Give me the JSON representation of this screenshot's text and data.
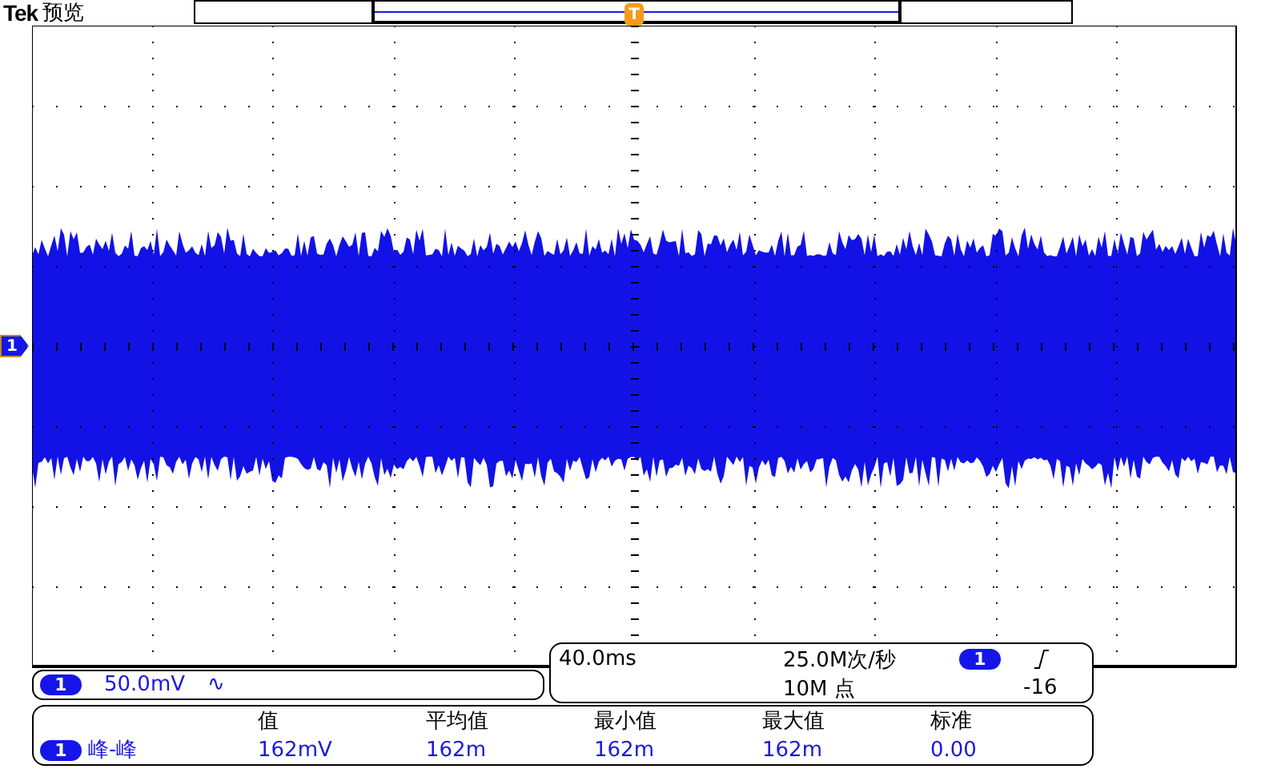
{
  "header": {
    "brand": "Tek",
    "mode": "预览"
  },
  "trigger_position": {
    "label": "T"
  },
  "channel_marker": {
    "label": "1"
  },
  "channel_scale": {
    "channel": "1",
    "scale": "50.0mV",
    "coupling_symbol": "∿"
  },
  "timebase": {
    "time_per_div": "40.0ms",
    "sample_rate": "25.0M次/秒",
    "record_length": "10M 点",
    "trigger_channel": "1",
    "trigger_level": "-16"
  },
  "measurements": {
    "columns": [
      "值",
      "平均值",
      "最小值",
      "最大值",
      "标准"
    ],
    "rows": [
      {
        "channel": "1",
        "name": "峰-峰",
        "values": [
          "162mV",
          "162m",
          "162m",
          "162m",
          "0.00"
        ]
      }
    ]
  }
}
